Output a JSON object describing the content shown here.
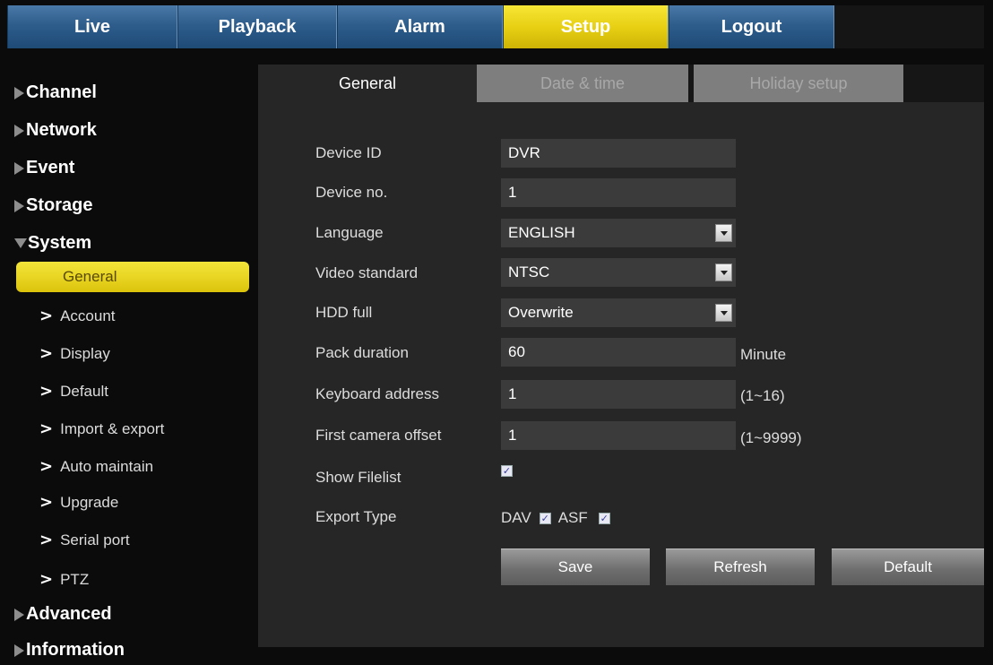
{
  "nav": {
    "tabs": [
      "Live",
      "Playback",
      "Alarm",
      "Setup",
      "Logout"
    ],
    "active_tab": "Setup"
  },
  "sidebar": {
    "sections": [
      "Channel",
      "Network",
      "Event",
      "Storage",
      "System",
      "Advanced",
      "Information"
    ],
    "expanded": "System",
    "system_items": [
      "General",
      "Account",
      "Display",
      "Default",
      "Import & export",
      "Auto maintain",
      "Upgrade",
      "Serial port",
      "PTZ"
    ],
    "active_item": "General"
  },
  "tabs": {
    "general": "General",
    "date_time": "Date & time",
    "holiday": "Holiday setup"
  },
  "form": {
    "device_id": {
      "label": "Device ID",
      "value": "DVR"
    },
    "device_no": {
      "label": "Device no.",
      "value": "1"
    },
    "language": {
      "label": "Language",
      "value": "ENGLISH"
    },
    "video_standard": {
      "label": "Video standard",
      "value": "NTSC"
    },
    "hdd_full": {
      "label": "HDD full",
      "value": "Overwrite"
    },
    "pack_duration": {
      "label": "Pack duration",
      "value": "60",
      "suffix": "Minute"
    },
    "keyboard_address": {
      "label": "Keyboard address",
      "value": "1",
      "suffix": "(1~16)"
    },
    "first_camera_offset": {
      "label": "First camera offset",
      "value": "1",
      "suffix": "(1~9999)"
    },
    "show_filelist": {
      "label": "Show Filelist",
      "checked": true
    },
    "export_type": {
      "label": "Export Type",
      "dav_label": "DAV",
      "dav_checked": true,
      "asf_label": "ASF",
      "asf_checked": true
    }
  },
  "buttons": {
    "save": "Save",
    "refresh": "Refresh",
    "default": "Default"
  },
  "icons": {
    "collapsed": "triangle-right-icon",
    "expanded": "triangle-down-icon",
    "sub_item": "chevron-right-icon",
    "dropdown": "dropdown-arrow-icon",
    "checkbox": "checkmark-icon"
  },
  "colors": {
    "nav_blue": "#2e5d8c",
    "active_yellow": "#e8d014",
    "panel_bg": "#262626",
    "field_bg": "#3b3b3b"
  }
}
